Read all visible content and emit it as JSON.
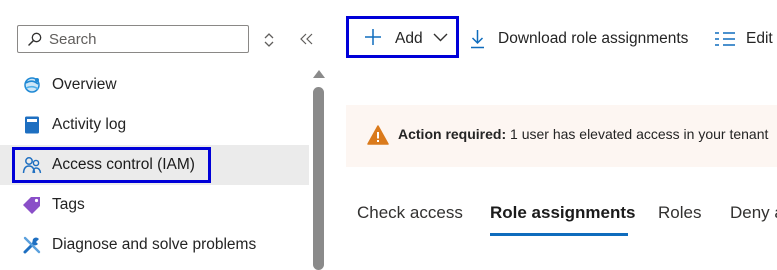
{
  "sidebar": {
    "search_placeholder": "Search",
    "items": [
      {
        "label": "Overview",
        "icon": "overview-icon"
      },
      {
        "label": "Activity log",
        "icon": "activity-log-icon"
      },
      {
        "label": "Access control (IAM)",
        "icon": "iam-icon",
        "selected": true
      },
      {
        "label": "Tags",
        "icon": "tag-icon"
      },
      {
        "label": "Diagnose and solve problems",
        "icon": "wrench-icon"
      }
    ]
  },
  "toolbar": {
    "add_label": "Add",
    "download_label": "Download role assignments",
    "edit_label": "Edit"
  },
  "banner": {
    "title": "Action required:",
    "message": "1 user has elevated access in your tenant"
  },
  "tabs": [
    {
      "label": "Check access"
    },
    {
      "label": "Role assignments",
      "active": true
    },
    {
      "label": "Roles"
    },
    {
      "label": "Deny assignments"
    }
  ],
  "colors": {
    "accent": "#0f6cbd",
    "focus_outline": "#0000d8",
    "warning": "#da7a1c",
    "banner_bg": "#fdf6f2",
    "selected_bg": "#ebebeb"
  }
}
